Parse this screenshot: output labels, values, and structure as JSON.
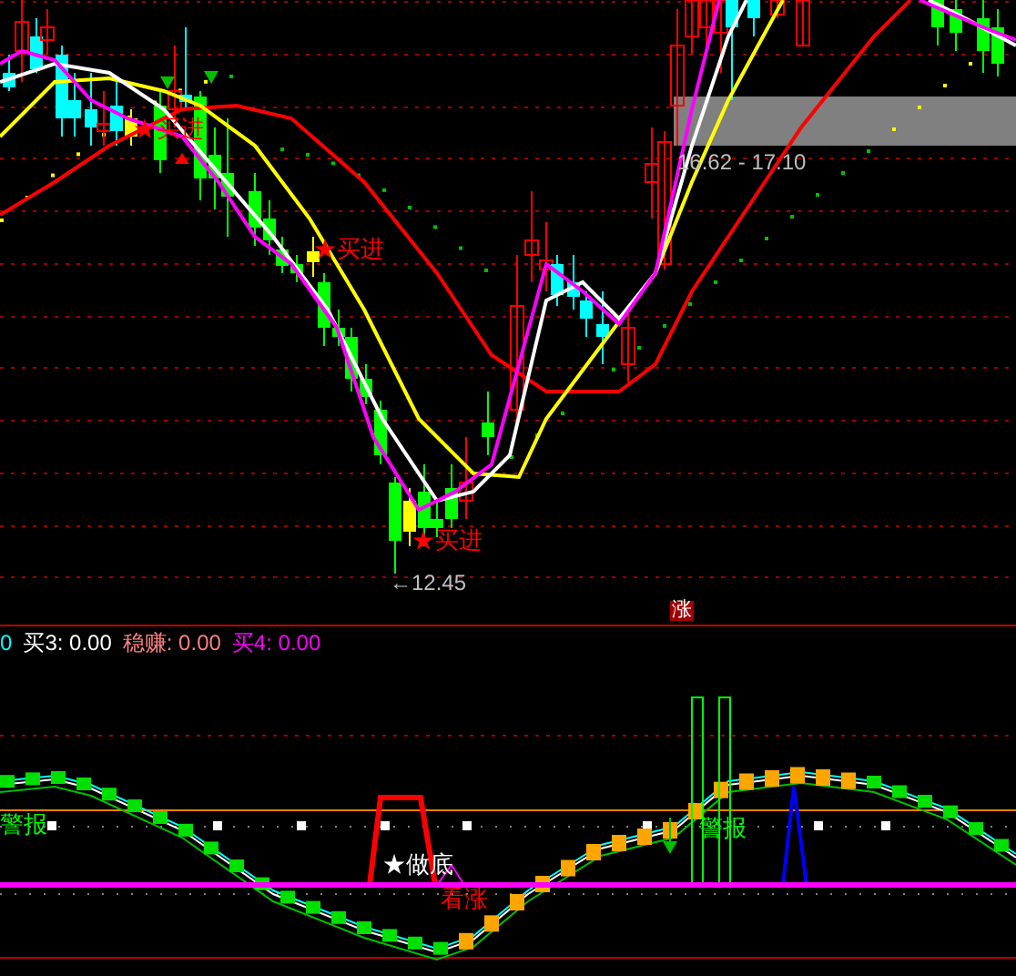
{
  "price_chart": {
    "markers": [
      {
        "text": "★买进"
      },
      {
        "text": "★买进"
      },
      {
        "text": "★买进"
      }
    ],
    "low_label": "←12.45",
    "range_label": "16.62 - 17.10",
    "badge": "涨"
  },
  "indicator": {
    "header": [
      {
        "text": "0",
        "color": "#00ffff"
      },
      {
        "text": "买3: 0.00",
        "color": "#ffffff"
      },
      {
        "text": "稳赚: 0.00",
        "color": "#ff8080"
      },
      {
        "text": "买4: 0.00",
        "color": "#ff00ff"
      }
    ],
    "labels": [
      {
        "text": "警报",
        "color": "#00ff00"
      },
      {
        "text": "★做底",
        "color": "#ffffff"
      },
      {
        "text": "看涨",
        "color": "#ff0000"
      },
      {
        "text": "警报",
        "color": "#00ff00"
      }
    ]
  }
}
